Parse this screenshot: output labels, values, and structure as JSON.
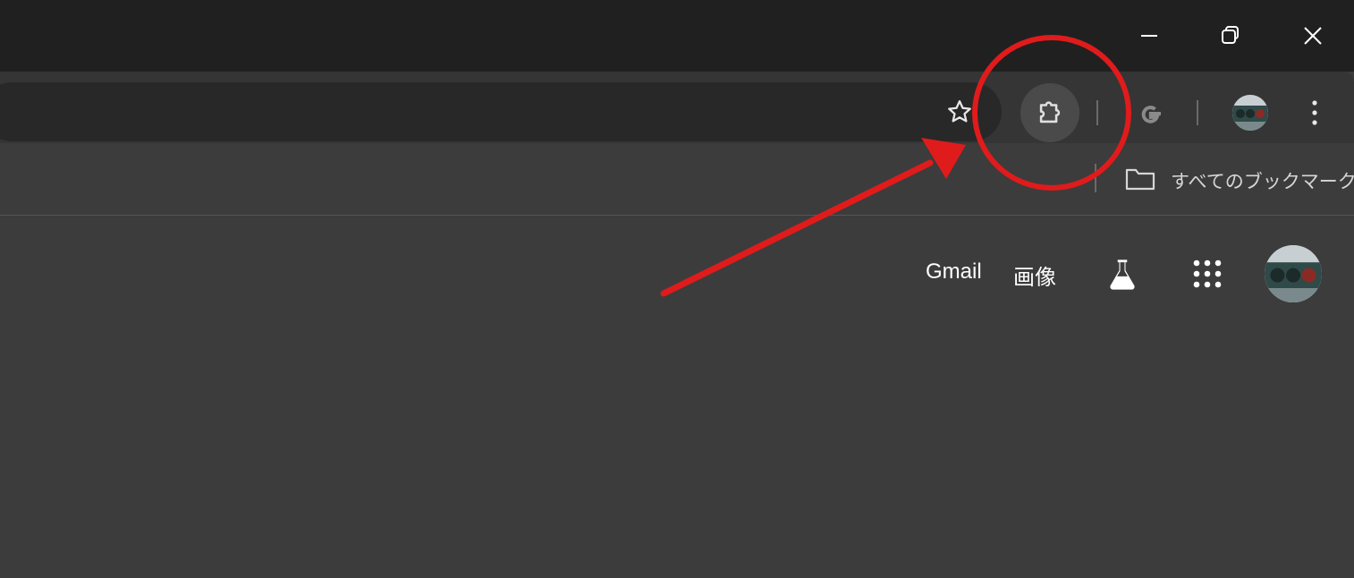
{
  "window_controls": {
    "minimize": "minimize-icon",
    "restore": "restore-icon",
    "close": "close-icon"
  },
  "toolbar": {
    "bookmark_star": "star-outline-icon",
    "extensions": "puzzle-icon",
    "google_extension": "google-g-icon",
    "profile": "avatar",
    "menu": "kebab-menu-icon"
  },
  "bookmarks_bar": {
    "all_bookmarks_label": "すべてのブックマーク",
    "folder_icon": "folder-icon"
  },
  "google_bar": {
    "gmail_label": "Gmail",
    "images_label": "画像",
    "labs_icon": "flask-icon",
    "apps_icon": "apps-grid-icon",
    "account_avatar": "avatar"
  },
  "annotation": {
    "color": "#e01b1b",
    "type": "circle-and-arrow"
  },
  "colors": {
    "titlebar": "#202020",
    "toolbar": "#353535",
    "omnibox": "#282828",
    "content": "#3c3c3c",
    "accent_red": "#e01b1b"
  }
}
